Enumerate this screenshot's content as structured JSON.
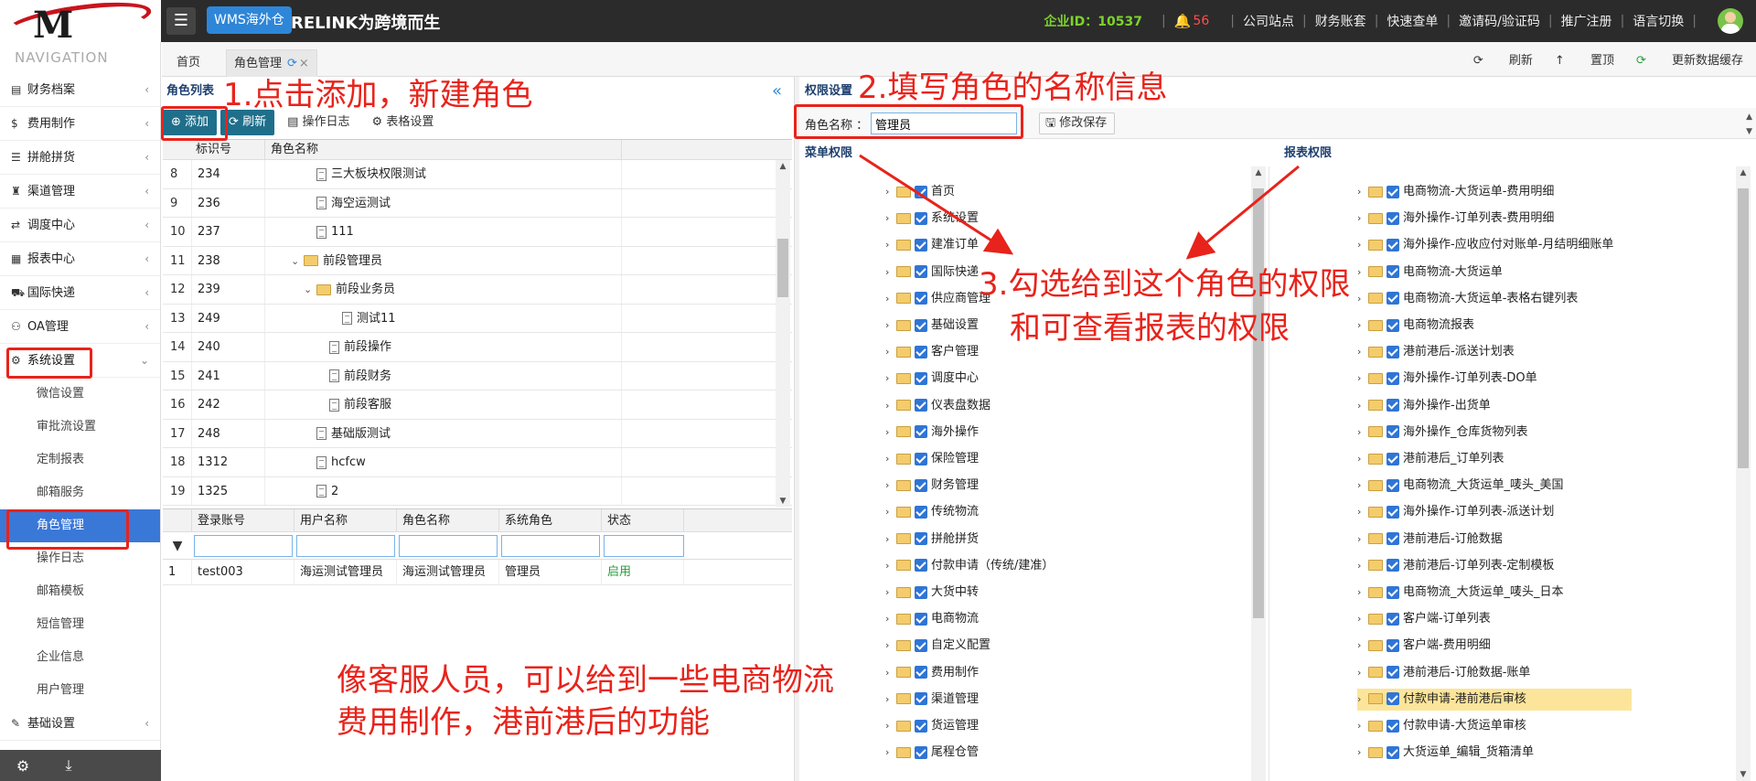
{
  "topbar": {
    "badge": "WMS海外仓",
    "brand": "RELINK为跨境而生",
    "company_id": "企业ID：10537",
    "bell_count": "56",
    "links": [
      "公司站点",
      "财务账套",
      "快速查单",
      "邀请码/验证码",
      "推广注册",
      "语言切换"
    ]
  },
  "sidebar": {
    "title": "NAVIGATION",
    "items": [
      {
        "label": "财务档案",
        "icon": "money-icon"
      },
      {
        "label": "费用制作",
        "icon": "dollar-icon"
      },
      {
        "label": "拼舱拼货",
        "icon": "list-icon"
      },
      {
        "label": "渠道管理",
        "icon": "road-icon"
      },
      {
        "label": "调度中心",
        "icon": "swap-icon"
      },
      {
        "label": "报表中心",
        "icon": "report-icon"
      },
      {
        "label": "国际快递",
        "icon": "truck-icon"
      },
      {
        "label": "OA管理",
        "icon": "group-icon"
      },
      {
        "label": "系统设置",
        "icon": "gear-icon"
      }
    ],
    "sub_items": [
      "微信设置",
      "审批流设置",
      "定制报表",
      "邮箱服务",
      "角色管理",
      "操作日志",
      "邮箱模板",
      "短信管理",
      "企业信息",
      "用户管理"
    ],
    "after_item": {
      "label": "基础设置",
      "icon": "edit-icon"
    }
  },
  "tabs": {
    "home": "首页",
    "role": "角色管理",
    "tools": [
      "刷新",
      "置顶",
      "更新数据缓存"
    ]
  },
  "role_panel": {
    "title": "角色列表",
    "toolbar": [
      "添加",
      "刷新",
      "操作日志",
      "表格设置"
    ],
    "columns": [
      "标识号",
      "角色名称"
    ],
    "rows": [
      {
        "rn": "8",
        "code": "234",
        "name": "三大板块权限测试",
        "level": 2,
        "kind": "doc"
      },
      {
        "rn": "9",
        "code": "236",
        "name": "海空运测试",
        "level": 2,
        "kind": "doc"
      },
      {
        "rn": "10",
        "code": "237",
        "name": "111",
        "level": 2,
        "kind": "doc"
      },
      {
        "rn": "11",
        "code": "238",
        "name": "前段管理员",
        "level": 1,
        "kind": "folder"
      },
      {
        "rn": "12",
        "code": "239",
        "name": "前段业务员",
        "level": 2,
        "kind": "folder"
      },
      {
        "rn": "13",
        "code": "249",
        "name": "测试11",
        "level": 4,
        "kind": "doc"
      },
      {
        "rn": "14",
        "code": "240",
        "name": "前段操作",
        "level": 3,
        "kind": "doc"
      },
      {
        "rn": "15",
        "code": "241",
        "name": "前段财务",
        "level": 3,
        "kind": "doc"
      },
      {
        "rn": "16",
        "code": "242",
        "name": "前段客服",
        "level": 3,
        "kind": "doc"
      },
      {
        "rn": "17",
        "code": "248",
        "name": "基础版测试",
        "level": 2,
        "kind": "doc"
      },
      {
        "rn": "18",
        "code": "1312",
        "name": "hcfcw",
        "level": 2,
        "kind": "doc"
      },
      {
        "rn": "19",
        "code": "1325",
        "name": "2",
        "level": 2,
        "kind": "doc"
      }
    ],
    "user_columns": [
      "登录账号",
      "用户名称",
      "角色名称",
      "系统角色",
      "状态"
    ],
    "user_rows": [
      {
        "rn": "1",
        "account": "test003",
        "user": "海运测试管理员",
        "role": "海运测试管理员",
        "sys": "管理员",
        "status": "启用"
      }
    ]
  },
  "perm_panel": {
    "title": "权限设置",
    "role_name_label": "角色名称",
    "role_name_value": "管理员",
    "save_label": "修改保存",
    "menu_title": "菜单权限",
    "report_title": "报表权限",
    "menu_items": [
      "首页",
      "系统设置",
      "建准订单",
      "国际快递",
      "供应商管理",
      "基础设置",
      "客户管理",
      "调度中心",
      "仪表盘数据",
      "海外操作",
      "保险管理",
      "财务管理",
      "传统物流",
      "拼舱拼货",
      "付款申请（传统/建准）",
      "大货中转",
      "电商物流",
      "自定义配置",
      "费用制作",
      "渠道管理",
      "货运管理",
      "尾程仓管"
    ],
    "report_items": [
      "电商物流-大货运单-费用明细",
      "海外操作-订单列表-费用明细",
      "海外操作-应收应付对账单-月结明细账单",
      "电商物流-大货运单",
      "电商物流-大货运单-表格右键列表",
      "电商物流报表",
      "港前港后-派送计划表",
      "海外操作-订单列表-DO单",
      "海外操作-出货单",
      "海外操作_仓库货物列表",
      "港前港后_订单列表",
      "电商物流_大货运单_唛头_美国",
      "海外操作-订单列表-派送计划",
      "港前港后-订舱数据",
      "港前港后-订单列表-定制模板",
      "电商物流_大货运单_唛头_日本",
      "客户端-订单列表",
      "客户端-费用明细",
      "港前港后-订舱数据-账单",
      "付款申请-港前港后审核",
      "付款申请-大货运单审核",
      "大货运单_编辑_货箱清单"
    ],
    "highlight_report": "付款申请-港前港后审核"
  },
  "annotations": {
    "step1": "1.点击添加，新建角色",
    "step2": "2.填写角色的名称信息",
    "step3_line1": "3.勾选给到这个角色的权限",
    "step3_line2": "和可查看报表的权限",
    "note_line1": "像客服人员，可以给到一些电商物流",
    "note_line2": "费用制作，港前港后的功能"
  },
  "colors": {
    "accent_blue": "#3a78d8",
    "annotation_red": "#e8231b",
    "company_id_green": "#7cd32c",
    "highlight_yellow": "#fce59a"
  }
}
